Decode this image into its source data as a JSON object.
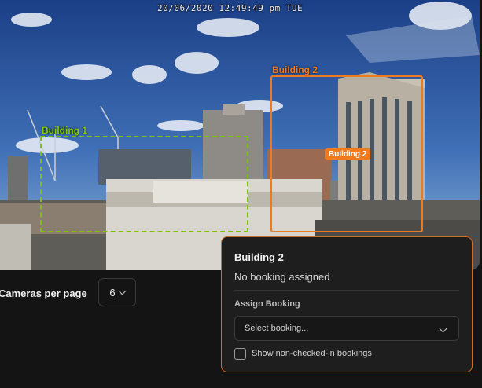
{
  "camera": {
    "timestamp": "20/06/2020 12:49:49 pm TUE",
    "zones": [
      {
        "name": "Building 1",
        "color": "#7dc400",
        "style": "dashed"
      },
      {
        "name": "Building 2",
        "color": "#f07a1e",
        "style": "solid",
        "selected": true
      }
    ],
    "selected_zone_tag": "Building 2"
  },
  "controls": {
    "cameras_per_page_label": "Cameras per page",
    "cameras_per_page_value": "6",
    "cameras_per_page_icon": "chevron-down-icon"
  },
  "booking_panel": {
    "title": "Building 2",
    "status": "No booking assigned",
    "assign_label": "Assign Booking",
    "select_placeholder": "Select booking...",
    "select_icon": "chevron-down-icon",
    "checkbox_label": "Show non-checked-in bookings",
    "checkbox_checked": false,
    "accent_color": "#d56a22"
  }
}
